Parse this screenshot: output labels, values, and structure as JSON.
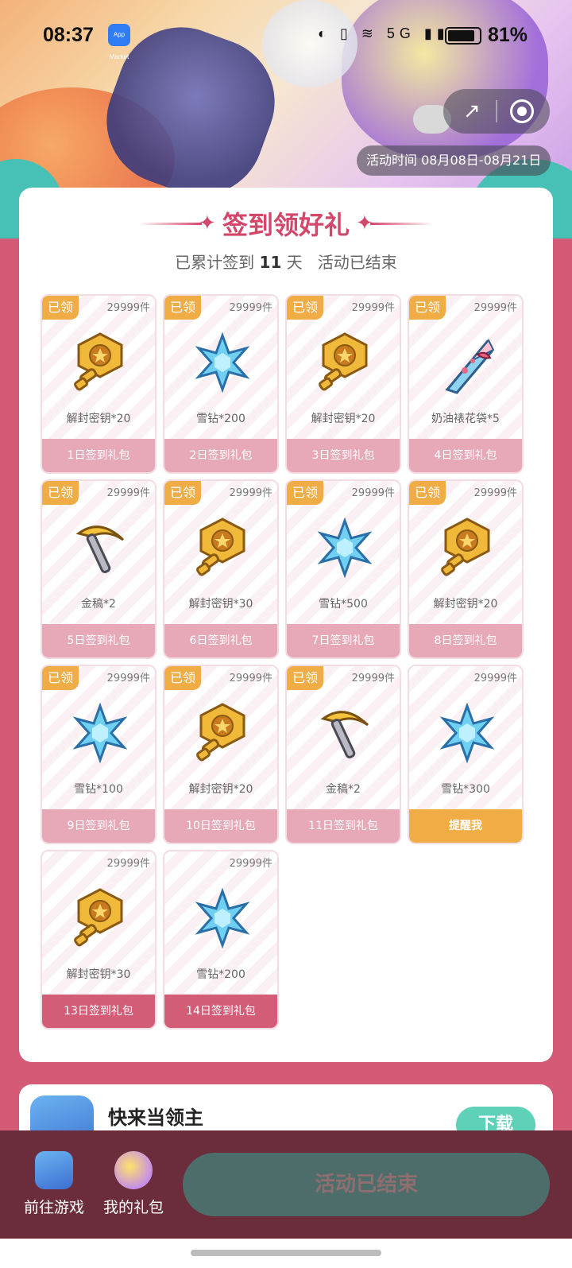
{
  "status_bar": {
    "time": "08:37",
    "battery": "81%",
    "app_icon_text": "App Market",
    "icons": "◐ ▯ ≋ 5G ▮▮"
  },
  "header": {
    "activity_period": "活动时间 08月08日-08月21日",
    "share_icon": "share-icon",
    "target_icon": "target-icon"
  },
  "signin": {
    "title": "签到领好礼",
    "summary_prefix": "已累计签到",
    "days": "11",
    "summary_suffix": "天",
    "status": "活动已结束",
    "rewards": [
      {
        "claimed": "已领",
        "stock": "29999件",
        "item": "解封密钥*20",
        "icon": "key-icon",
        "label": "1日签到礼包"
      },
      {
        "claimed": "已领",
        "stock": "29999件",
        "item": "雪钻*200",
        "icon": "snowflake-icon",
        "label": "2日签到礼包"
      },
      {
        "claimed": "已领",
        "stock": "29999件",
        "item": "解封密钥*20",
        "icon": "key-icon",
        "label": "3日签到礼包"
      },
      {
        "claimed": "已领",
        "stock": "29999件",
        "item": "奶油裱花袋*5",
        "icon": "piping-bag-icon",
        "label": "4日签到礼包"
      },
      {
        "claimed": "已领",
        "stock": "29999件",
        "item": "金稿*2",
        "icon": "pickaxe-icon",
        "label": "5日签到礼包"
      },
      {
        "claimed": "已领",
        "stock": "29999件",
        "item": "解封密钥*30",
        "icon": "key-icon",
        "label": "6日签到礼包"
      },
      {
        "claimed": "已领",
        "stock": "29999件",
        "item": "雪钻*500",
        "icon": "snowflake-icon",
        "label": "7日签到礼包"
      },
      {
        "claimed": "已领",
        "stock": "29999件",
        "item": "解封密钥*20",
        "icon": "key-icon",
        "label": "8日签到礼包"
      },
      {
        "claimed": "已领",
        "stock": "29999件",
        "item": "雪钻*100",
        "icon": "snowflake-icon",
        "label": "9日签到礼包"
      },
      {
        "claimed": "已领",
        "stock": "29999件",
        "item": "解封密钥*20",
        "icon": "key-icon",
        "label": "10日签到礼包"
      },
      {
        "claimed": "已领",
        "stock": "29999件",
        "item": "金稿*2",
        "icon": "pickaxe-icon",
        "label": "11日签到礼包"
      },
      {
        "claimed": "",
        "stock": "29999件",
        "item": "雪钻*300",
        "icon": "snowflake-icon",
        "label": "提醒我"
      },
      {
        "claimed": "",
        "stock": "29999件",
        "item": "解封密钥*30",
        "icon": "key-icon",
        "label": "13日签到礼包"
      },
      {
        "claimed": "",
        "stock": "29999件",
        "item": "雪钻*200",
        "icon": "snowflake-icon",
        "label": "14日签到礼包"
      }
    ]
  },
  "game": {
    "name": "快来当领主",
    "download_label": "下载"
  },
  "bottom_bar": {
    "go_game": "前往游戏",
    "my_gifts": "我的礼包",
    "ended_button": "活动已结束"
  },
  "colors": {
    "brand_pink": "#d2476a",
    "badge_orange": "#f0ac45",
    "page_bg": "#d45a76",
    "bottom_bg": "#6b2c3b"
  }
}
